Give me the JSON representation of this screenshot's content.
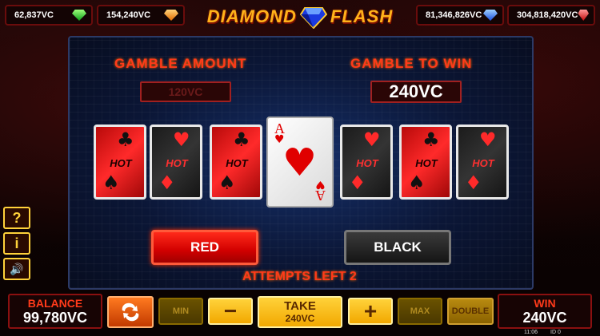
{
  "jackpots": [
    {
      "value": "62,837VC",
      "gem": "green"
    },
    {
      "value": "154,240VC",
      "gem": "orange"
    },
    {
      "value": "81,346,826VC",
      "gem": "blue"
    },
    {
      "value": "304,818,420VC",
      "gem": "red"
    }
  ],
  "logo": {
    "left": "DIAMOND",
    "right": "FLASH"
  },
  "gamble": {
    "amount_label": "GAMBLE AMOUNT",
    "amount_value": "120VC",
    "to_win_label": "GAMBLE TO WIN",
    "to_win_value": "240VC",
    "attempts": "ATTEMPTS LEFT 2"
  },
  "history_cards": [
    {
      "back": "red",
      "suit": "♣",
      "text": "HOT"
    },
    {
      "back": "dark",
      "suit": "♥",
      "text": "HOT"
    },
    {
      "back": "red",
      "suit": "♣",
      "text": "HOT"
    },
    {
      "back": "dark",
      "suit": "♥",
      "text": "HOT"
    },
    {
      "back": "red",
      "suit": "♣",
      "text": "HOT"
    },
    {
      "back": "dark",
      "suit": "♥",
      "text": "HOT"
    }
  ],
  "current_card": {
    "rank": "A",
    "suit": "♥"
  },
  "choices": {
    "red": "RED",
    "black": "BLACK"
  },
  "side_buttons": {
    "help": "?",
    "info": "i",
    "sound": "🔊"
  },
  "bottom": {
    "balance_label": "BALANCE",
    "balance_value": "99,780VC",
    "min": "MIN",
    "minus": "−",
    "take_label": "TAKE",
    "take_value": "240VC",
    "plus": "+",
    "max": "MAX",
    "double": "DOUBLE",
    "win_label": "WIN",
    "win_value": "240VC",
    "time": "11:06",
    "id": "ID 0"
  }
}
